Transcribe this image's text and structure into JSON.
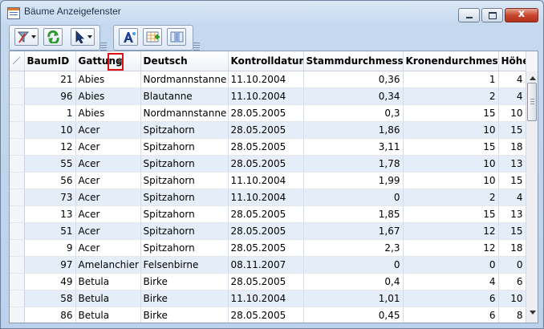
{
  "window": {
    "title": "Bäume Anzeigefenster",
    "close_glyph": "x"
  },
  "toolbar": {
    "icons": [
      "filter-icon",
      "refresh-icon",
      "pointer-icon",
      "text-style-icon",
      "add-grid-icon",
      "columns-icon"
    ]
  },
  "grid": {
    "sort_indicator": "▲",
    "columns": [
      "BaumID",
      "Gattung",
      "Deutsch",
      "Kontrolldatum",
      "Stammdurchmesser",
      "Kronendurchmesser",
      "Höhe"
    ],
    "rows": [
      [
        "21",
        "Abies",
        "Nordmannstanne",
        "11.10.2004",
        "0,36",
        "1",
        "4"
      ],
      [
        "96",
        "Abies",
        "Blautanne",
        "11.10.2004",
        "0,34",
        "2",
        "4"
      ],
      [
        "1",
        "Abies",
        "Nordmannstanne",
        "28.05.2005",
        "0,3",
        "15",
        "10"
      ],
      [
        "10",
        "Acer",
        "Spitzahorn",
        "28.05.2005",
        "1,86",
        "10",
        "15"
      ],
      [
        "12",
        "Acer",
        "Spitzahorn",
        "28.05.2005",
        "3,11",
        "15",
        "18"
      ],
      [
        "55",
        "Acer",
        "Spitzahorn",
        "28.05.2005",
        "1,78",
        "10",
        "13"
      ],
      [
        "56",
        "Acer",
        "Spitzahorn",
        "11.10.2004",
        "1,99",
        "10",
        "15"
      ],
      [
        "73",
        "Acer",
        "Spitzahorn",
        "11.10.2004",
        "0",
        "2",
        "4"
      ],
      [
        "13",
        "Acer",
        "Spitzahorn",
        "28.05.2005",
        "1,85",
        "15",
        "13"
      ],
      [
        "51",
        "Acer",
        "Spitzahorn",
        "28.05.2005",
        "1,67",
        "12",
        "15"
      ],
      [
        "9",
        "Acer",
        "Spitzahorn",
        "28.05.2005",
        "2,3",
        "12",
        "18"
      ],
      [
        "97",
        "Amelanchier",
        "Felsenbirne",
        "08.11.2007",
        "0",
        "0",
        "0"
      ],
      [
        "49",
        "Betula",
        "Birke",
        "28.05.2005",
        "0,4",
        "4",
        "6"
      ],
      [
        "58",
        "Betula",
        "Birke",
        "11.10.2004",
        "1,01",
        "6",
        "10"
      ],
      [
        "86",
        "Betula",
        "Birke",
        "28.05.2005",
        "0,45",
        "6",
        "8"
      ]
    ]
  },
  "colors": {
    "row_alt": "#e5eef8",
    "highlight": "#e01010"
  }
}
